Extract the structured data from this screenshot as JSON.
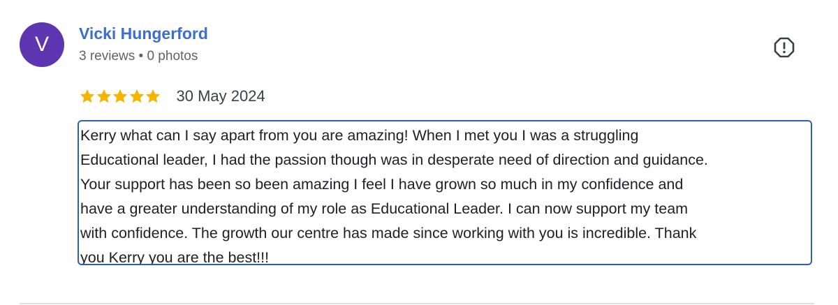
{
  "reviewer": {
    "initial": "V",
    "name": "Vicki Hungerford",
    "meta": "3 reviews • 0 photos",
    "avatar_color": "#5e35b1"
  },
  "review": {
    "rating": 5,
    "rating_max": 5,
    "star_color": "#f5b400",
    "date": "30 May 2024",
    "text": "Kerry what can I say apart from you are amazing! When I met you I was a struggling\nEducational leader, I had the passion though was in desperate need of direction and guidance.\nYour support has been so been amazing I feel I have grown so much in my confidence and\nhave a greater understanding of my role as Educational Leader. I can now support my team\nwith confidence. The growth our centre has made since working with you is incredible. Thank\nyou Kerry you are the best!!!"
  },
  "icons": {
    "report": "report-flag-icon",
    "star": "star-icon"
  },
  "colors": {
    "name_link": "#3b6fcc",
    "selection_border": "#2f5fb3"
  }
}
